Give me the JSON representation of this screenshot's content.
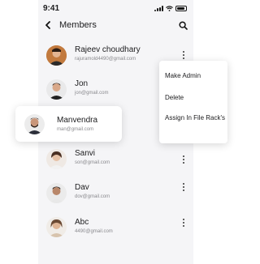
{
  "status": {
    "time": "9:41"
  },
  "header": {
    "title": "Members",
    "back_icon": "chevron-left-icon",
    "search_icon": "search-icon"
  },
  "members": [
    {
      "name": "Rajeev choudhary",
      "email": "rajuramold4490@gmail.com"
    },
    {
      "name": "Jon",
      "email": "jon@gmail.com"
    },
    {
      "name": "Manvendra",
      "email": "man@gmail.com"
    },
    {
      "name": "Sanvi",
      "email": "son@gmail.com"
    },
    {
      "name": "Dav",
      "email": "dov@gmail.com"
    },
    {
      "name": "Abc",
      "email": "4490@gmail.com"
    }
  ],
  "menu": {
    "items": [
      {
        "label": "Make Admin"
      },
      {
        "label": "Delete"
      },
      {
        "label": "Assign In File Rack's"
      }
    ]
  },
  "colors": {
    "background": "#f5f5f7",
    "card": "#ffffff",
    "text": "#1c1c1e",
    "muted": "#8a8a8e"
  }
}
